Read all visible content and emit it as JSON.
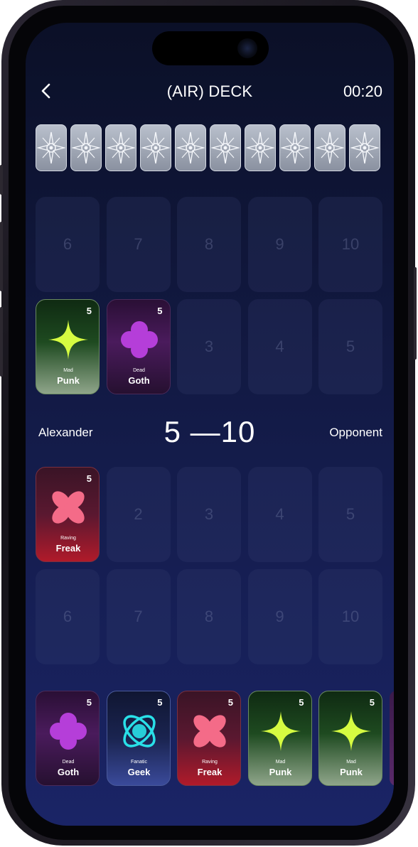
{
  "header": {
    "title": "(AIR) DECK",
    "timer": "00:20"
  },
  "deck": {
    "count": 10,
    "icon": "star-eye-icon"
  },
  "colors": {
    "punk": "#d6fb41",
    "goth": "#b53ed9",
    "freak": "#f46b88",
    "geek": "#29e0e8"
  },
  "opponent_rows": {
    "top": [
      {
        "type": "slot",
        "label": "6"
      },
      {
        "type": "slot",
        "label": "7"
      },
      {
        "type": "slot",
        "label": "8"
      },
      {
        "type": "slot",
        "label": "9"
      },
      {
        "type": "slot",
        "label": "10"
      }
    ],
    "bottom": [
      {
        "type": "card",
        "kind": "punk",
        "num": "5",
        "adj": "Mad",
        "noun": "Punk",
        "icon": "four-point-star-icon"
      },
      {
        "type": "card",
        "kind": "goth",
        "num": "5",
        "adj": "Dead",
        "noun": "Goth",
        "icon": "clover-icon"
      },
      {
        "type": "slot",
        "label": "3"
      },
      {
        "type": "slot",
        "label": "4"
      },
      {
        "type": "slot",
        "label": "5"
      }
    ]
  },
  "scoreboard": {
    "player": "Alexander",
    "score": "5 —10",
    "opponent": "Opponent"
  },
  "player_rows": {
    "top": [
      {
        "type": "card",
        "kind": "freak",
        "num": "5",
        "adj": "Raving",
        "noun": "Freak",
        "icon": "x-petal-icon"
      },
      {
        "type": "slot",
        "label": "2"
      },
      {
        "type": "slot",
        "label": "3"
      },
      {
        "type": "slot",
        "label": "4"
      },
      {
        "type": "slot",
        "label": "5"
      }
    ],
    "bottom": [
      {
        "type": "slot",
        "label": "6"
      },
      {
        "type": "slot",
        "label": "7"
      },
      {
        "type": "slot",
        "label": "8"
      },
      {
        "type": "slot",
        "label": "9"
      },
      {
        "type": "slot",
        "label": "10"
      }
    ]
  },
  "hand": [
    {
      "kind": "goth",
      "num": "5",
      "adj": "Dead",
      "noun": "Goth",
      "icon": "clover-icon"
    },
    {
      "kind": "geek",
      "num": "5",
      "adj": "Fanatic",
      "noun": "Geek",
      "icon": "atom-icon"
    },
    {
      "kind": "freak",
      "num": "5",
      "adj": "Raving",
      "noun": "Freak",
      "icon": "x-petal-icon"
    },
    {
      "kind": "punk",
      "num": "5",
      "adj": "Mad",
      "noun": "Punk",
      "icon": "four-point-star-icon"
    },
    {
      "kind": "punk",
      "num": "5",
      "adj": "Mad",
      "noun": "Punk",
      "icon": "four-point-star-icon"
    }
  ]
}
